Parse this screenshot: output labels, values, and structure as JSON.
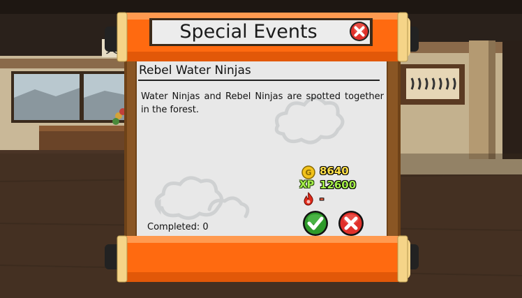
{
  "dialog": {
    "title": "Special Events",
    "event_name": "Rebel Water Ninjas",
    "description": "Water Ninjas and Rebel Ninjas are spotted together in the forest.",
    "rewards": {
      "gold": "8640",
      "xp_label": "XP",
      "xp": "12600",
      "other": "-"
    },
    "completed_label": "Completed: 0"
  },
  "icons": {
    "close": "close-icon",
    "gold": "gold-coin-icon",
    "xp": "xp-icon",
    "other": "flame-icon",
    "accept": "check-icon",
    "decline": "x-icon"
  },
  "colors": {
    "scroll_orange": "#ff6a10",
    "scroll_wood": "#7a4a1e",
    "close_red": "#e0302a",
    "accept_green": "#2e9a2a",
    "gold_text": "#ffe04a",
    "xp_text": "#a6f04a"
  }
}
